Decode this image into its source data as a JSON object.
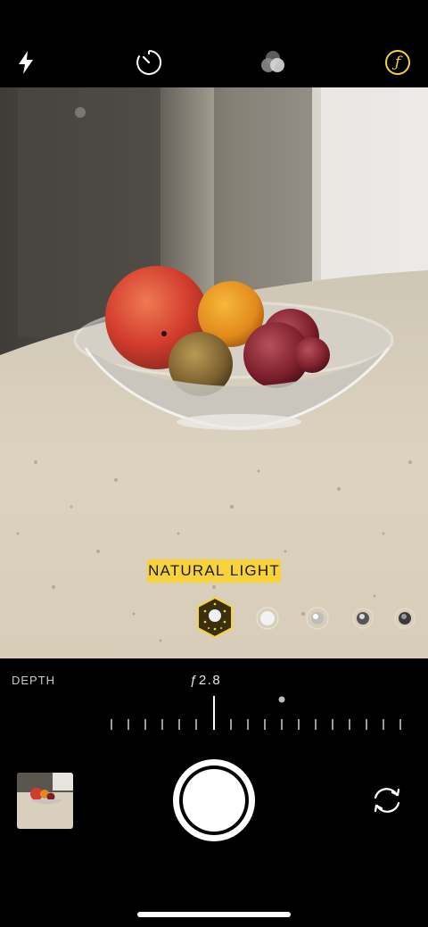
{
  "top_bar": {
    "icons": [
      "flash-icon",
      "timer-icon",
      "filters-icon",
      "depth-aperture-icon"
    ],
    "depth_icon_glyph": "ƒ",
    "accent": "#f6d33b"
  },
  "viewfinder": {
    "lighting_mode": "NATURAL LIGHT",
    "lighting_options": [
      "natural-light",
      "studio-light",
      "contour-light",
      "stage-light",
      "stage-light-mono"
    ],
    "selected_option": "natural-light"
  },
  "depth_control": {
    "label": "DEPTH",
    "value": "ƒ2.8"
  },
  "bottom_bar": {
    "icons": [
      "last-photo-thumbnail",
      "shutter-button",
      "flip-camera-icon"
    ]
  }
}
